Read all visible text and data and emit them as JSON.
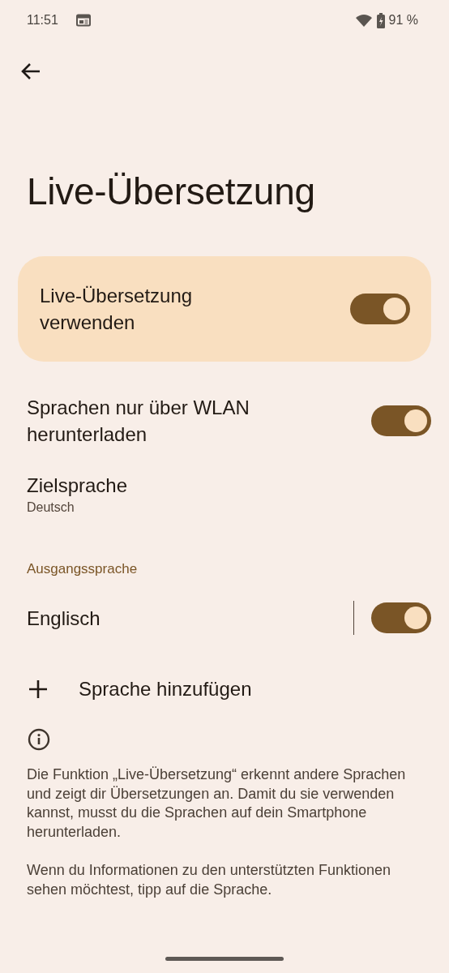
{
  "status_bar": {
    "time": "11:51",
    "battery": "91 %"
  },
  "title": "Live-Übersetzung",
  "main_switch": {
    "label": "Live-Übersetzung verwenden",
    "on": true
  },
  "settings": [
    {
      "kind": "switch",
      "label": "Sprachen nur über WLAN herunterladen",
      "on": true
    },
    {
      "kind": "choice",
      "label": "Zielsprache",
      "summary": "Deutsch"
    }
  ],
  "source_section": {
    "header": "Ausgangssprache",
    "languages": [
      {
        "label": "Englisch",
        "on": true
      }
    ],
    "add_label": "Sprache hinzufügen"
  },
  "footer": {
    "paragraphs": [
      "Die Funktion „Live-Übersetzung“ erkennt andere Sprachen und zeigt dir Übersetzungen an. Damit du sie verwenden kannst, musst du die Sprachen auf dein Smartphone herunterladen.",
      "Wenn du Informationen zu den unterstützten Funktionen sehen möchtest, tipp auf die Sprache."
    ]
  }
}
